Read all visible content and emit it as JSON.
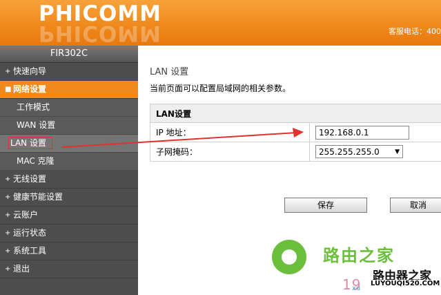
{
  "header": {
    "logo": "PHICOMM",
    "hotline": "客服电话：400"
  },
  "sidebar": {
    "model": "FIR302C",
    "items": [
      {
        "label": "快速向导"
      },
      {
        "label": "网络设置",
        "active": true
      },
      {
        "label": "无线设置"
      },
      {
        "label": "健康节能设置"
      },
      {
        "label": "云账户"
      },
      {
        "label": "运行状态"
      },
      {
        "label": "系统工具"
      },
      {
        "label": "退出"
      }
    ],
    "sub_items": [
      {
        "label": "工作模式"
      },
      {
        "label": "WAN 设置"
      },
      {
        "label": "LAN 设置",
        "current": true
      },
      {
        "label": "MAC 克隆"
      }
    ],
    "bullet": "+"
  },
  "main": {
    "title": "LAN 设置",
    "description": "当前页面可以配置局域网的相关参数。",
    "table": {
      "header": "LAN设置",
      "ip_label": "IP 地址：",
      "ip_value": "192.168.0.1",
      "mask_label": "子网掩码：",
      "mask_value": "255.255.255.0"
    },
    "buttons": {
      "save": "保存",
      "cancel": "取消"
    }
  },
  "watermark": {
    "brand": "路由之家",
    "number": "19",
    "brand2": "路由器之家",
    "site": "LUYOUQI520.COM",
    "partial": "xu"
  },
  "colors": {
    "header_orange": "#f08a1c",
    "sidebar_bg": "#4d4d4d",
    "annotation_red": "#e03030",
    "watermark_green": "#6cbf3c"
  }
}
